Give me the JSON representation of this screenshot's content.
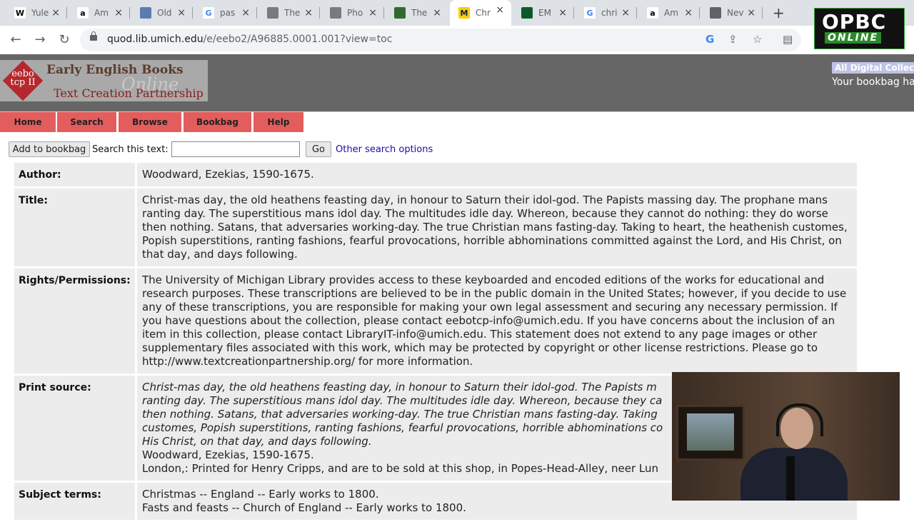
{
  "browser": {
    "tabs": [
      {
        "title": "Yule",
        "fav": "W",
        "fav_color": "#ffffff",
        "fav_text": "#000000"
      },
      {
        "title": "Am",
        "fav": "a",
        "fav_color": "#ffffff",
        "fav_text": "#000000"
      },
      {
        "title": "Old",
        "fav": "",
        "fav_color": "#5b7cb3",
        "fav_text": "#ffffff"
      },
      {
        "title": "pas",
        "fav": "G",
        "fav_color": "#ffffff",
        "fav_text": "#4285f4"
      },
      {
        "title": "The",
        "fav": "",
        "fav_color": "#7a7a7a",
        "fav_text": "#ffffff"
      },
      {
        "title": "Pho",
        "fav": "",
        "fav_color": "#7a7a7a",
        "fav_text": "#ffffff"
      },
      {
        "title": "The",
        "fav": "",
        "fav_color": "#2f6b2f",
        "fav_text": "#ffffff"
      },
      {
        "title": "Chr",
        "fav": "M",
        "fav_color": "#ffcb05",
        "fav_text": "#00274c"
      },
      {
        "title": "EM",
        "fav": "",
        "fav_color": "#0b5a2a",
        "fav_text": "#ffffff"
      },
      {
        "title": "chri",
        "fav": "G",
        "fav_color": "#ffffff",
        "fav_text": "#4285f4"
      },
      {
        "title": "Am",
        "fav": "a",
        "fav_color": "#ffffff",
        "fav_text": "#000000"
      },
      {
        "title": "Nev",
        "fav": "",
        "fav_color": "#5f6368",
        "fav_text": "#ffffff"
      }
    ],
    "new_tab": "+",
    "close_glyph": "×",
    "back": "←",
    "forward": "→",
    "reload": "↻",
    "url_host": "quod.lib.umich.edu",
    "url_path": "/e/eebo2/A96885.0001.001?view=toc"
  },
  "overlay": {
    "logo_line1": "OPBC",
    "logo_line2": "ONLINE"
  },
  "site": {
    "logo_line1": "Early English Books",
    "logo_line2": "Online",
    "logo_line3": "Text Creation Partnership",
    "seal": "eebo tcp II",
    "all_collections": "All Digital Collectio",
    "bookbag": "Your bookbag ha",
    "nav": [
      "Home",
      "Search",
      "Browse",
      "Bookbag",
      "Help"
    ]
  },
  "search": {
    "add_button": "Add to bookbag",
    "label": "Search this text:",
    "input_value": "",
    "go_button": "Go",
    "other_link": "Other search options"
  },
  "record": {
    "author_label": "Author:",
    "author": "Woodward, Ezekias, 1590-1675.",
    "title_label": "Title:",
    "title": "Christ-mas day, the old heathens feasting day, in honour to Saturn their idol-god. The Papists massing day. The prophane mans ranting day. The superstitious mans idol day. The multitudes idle day. Whereon, because they cannot do nothing: they do worse then nothing. Satans, that adversaries working-day. The true Christian mans fasting-day. Taking to heart, the heathenish customes, Popish superstitions, ranting fashions, fearful provocations, horrible abhominations committed against the Lord, and His Christ, on that day, and days following.",
    "rights_label": "Rights/Permissions:",
    "rights": "The University of Michigan Library provides access to these keyboarded and encoded editions of the works for educational and research purposes. These transcriptions are believed to be in the public domain in the United States; however, if you decide to use any of these transcriptions, you are responsible for making your own legal assessment and securing any necessary permission. If you have questions about the collection, please contact eebotcp-info@umich.edu. If you have concerns about the inclusion of an item in this collection, please contact LibraryIT-info@umich.edu. This statement does not extend to any page images or other supplementary files associated with this work, which may be protected by copyright or other license restrictions. Please go to http://www.textcreationpartnership.org/ for more information.",
    "print_label": "Print source:",
    "print_title": "Christ-mas day, the old heathens feasting day, in honour to Saturn their idol-god. The Papists m",
    "print_title_2": "ranting day. The superstitious mans idol day. The multitudes idle day. Whereon, because they ca",
    "print_title_3": "then nothing. Satans, that adversaries working-day. The true Christian mans fasting-day. Taking",
    "print_title_4": "customes, Popish superstitions, ranting fashions, fearful provocations, horrible abhominations co",
    "print_title_5": "His Christ, on that day, and days following.",
    "print_author": "Woodward, Ezekias, 1590-1675.",
    "print_imprint": "London,: Printed for Henry Cripps, and are to be sold at this shop, in Popes-Head-Alley, neer Lun",
    "subject_label": "Subject terms:",
    "subject_1": "Christmas -- England -- Early works to 1800.",
    "subject_2": "Fasts and feasts -- Church of England -- Early works to 1800."
  }
}
